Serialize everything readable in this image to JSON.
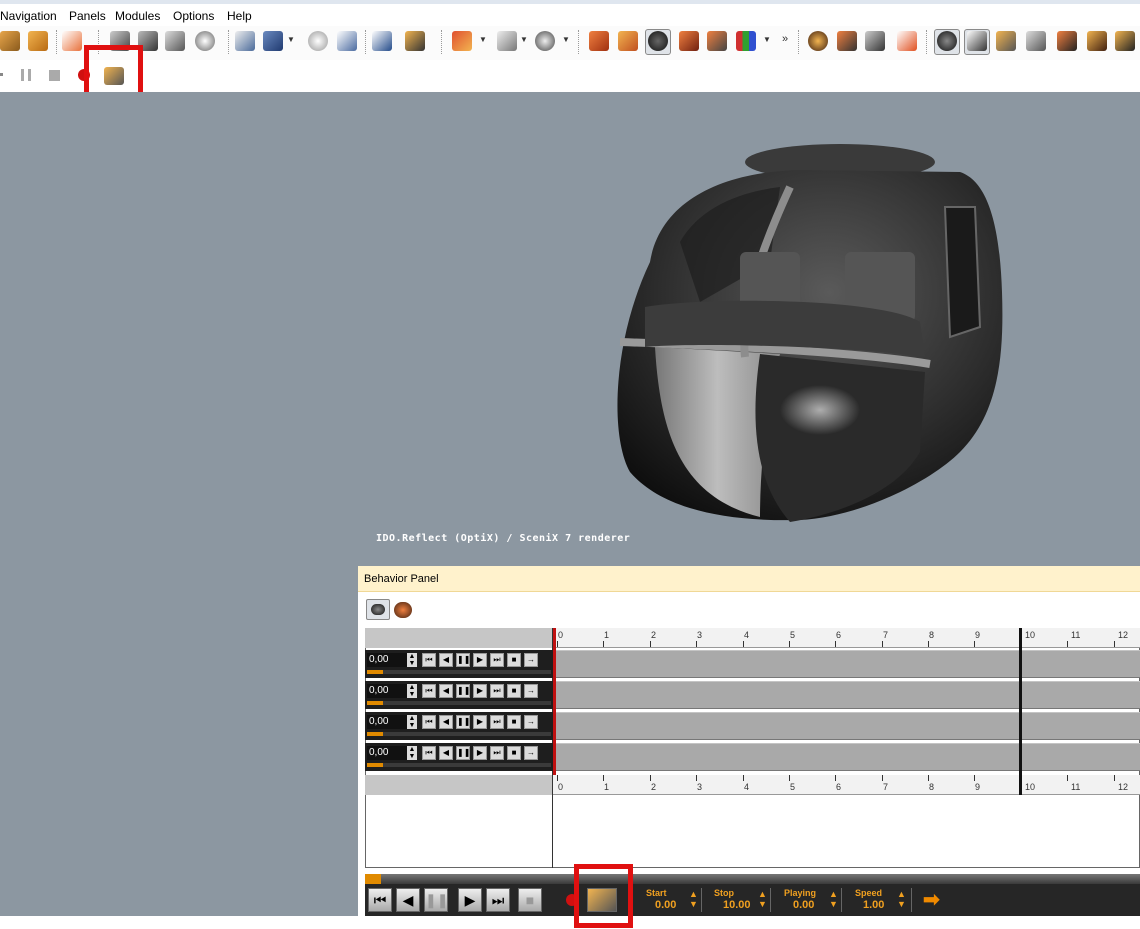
{
  "menu": [
    "Navigation",
    "Panels",
    "Modules",
    "Options",
    "Help"
  ],
  "render_label": "IDO.Reflect (OptiX) / SceniX 7 renderer",
  "behavior_panel": {
    "title": "Behavior Panel",
    "rows": [
      {
        "value": "0,00"
      },
      {
        "value": "0,00"
      },
      {
        "value": "0,00"
      },
      {
        "value": "0,00"
      }
    ],
    "ruler_labels": [
      "0",
      "1",
      "2",
      "3",
      "4",
      "5",
      "6",
      "7",
      "8",
      "9",
      "10",
      "11",
      "12"
    ]
  },
  "transport": {
    "start_label": "Start",
    "start_value": "0.00",
    "stop_label": "Stop",
    "stop_value": "10.00",
    "playing_label": "Playing",
    "playing_value": "0.00",
    "speed_label": "Speed",
    "speed_value": "1.00"
  },
  "colors": {
    "accent_orange": "#e08a00",
    "highlight_red": "#e01010",
    "viewport_bg": "#8c97a1"
  }
}
